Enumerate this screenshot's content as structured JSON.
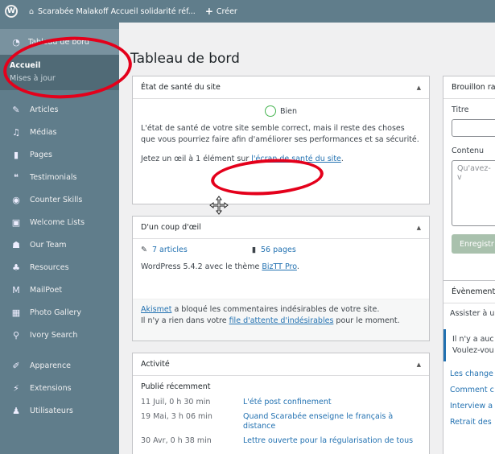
{
  "adminbar": {
    "site": "Scarabée Malakoff Accueil solidarité réf...",
    "new": "Créer"
  },
  "sidebar": {
    "current": "Tableau de bord",
    "sub": [
      "Accueil",
      "Mises à jour"
    ],
    "items": [
      {
        "label": "Articles",
        "icon": "pin-icon"
      },
      {
        "label": "Médias",
        "icon": "media-icon"
      },
      {
        "label": "Pages",
        "icon": "page-icon"
      },
      {
        "label": "Testimonials",
        "icon": "quote-icon"
      },
      {
        "label": "Counter Skills",
        "icon": "counter-icon"
      },
      {
        "label": "Welcome Lists",
        "icon": "list-icon"
      },
      {
        "label": "Our Team",
        "icon": "team-icon"
      },
      {
        "label": "Resources",
        "icon": "resources-icon"
      },
      {
        "label": "MailPoet",
        "icon": "mailpoet-icon"
      },
      {
        "label": "Photo Gallery",
        "icon": "gallery-icon"
      },
      {
        "label": "Ivory Search",
        "icon": "search-icon"
      },
      {
        "label": "Apparence",
        "icon": "brush-icon"
      },
      {
        "label": "Extensions",
        "icon": "plugin-icon"
      },
      {
        "label": "Utilisateurs",
        "icon": "users-icon"
      }
    ]
  },
  "page": {
    "title": "Tableau de bord"
  },
  "health": {
    "title": "État de santé du site",
    "status": "Bien",
    "text": "L'état de santé de votre site semble correct, mais il reste des choses que vous pourriez faire afin d'améliorer ses performances et sa sécurité.",
    "check_prefix": "Jetez un œil à 1 élément sur ",
    "check_link": "l'écran de santé du site",
    "check_suffix": "."
  },
  "glance": {
    "title": "D'un coup d'œil",
    "articles": "7 articles",
    "pages": "56 pages",
    "wp_prefix": "WordPress 5.4.2 avec le thème ",
    "theme": "BizTT Pro",
    "wp_suffix": ".",
    "akismet": "Akismet",
    "akismet_text": " a bloqué les commentaires indésirables de votre site.",
    "queue_prefix": "Il n'y a rien dans votre ",
    "queue_link": "file d'attente d'indésirables",
    "queue_suffix": " pour le moment."
  },
  "activity": {
    "title": "Activité",
    "recent": "Publié récemment",
    "rows": [
      {
        "date": "11 Juil, 0 h 30 min",
        "title": "L'été post confinement"
      },
      {
        "date": "19 Mai, 3 h 06 min",
        "title": "Quand Scarabée enseigne le français à distance"
      },
      {
        "date": "30 Avr, 0 h 38 min",
        "title": "Lettre ouverte pour la régularisation de tous"
      }
    ]
  },
  "draft": {
    "title": "Brouillon ra",
    "titre": "Titre",
    "contenu": "Contenu",
    "placeholder": "Qu'avez-v",
    "save": "Enregistr"
  },
  "events": {
    "title": "Évènement",
    "attend": "Assister à u",
    "none1": "Il n'y a auc",
    "none2": "Voulez-vou",
    "news": [
      "Les change",
      "Comment c",
      "Interview a",
      "Retrait des"
    ]
  }
}
